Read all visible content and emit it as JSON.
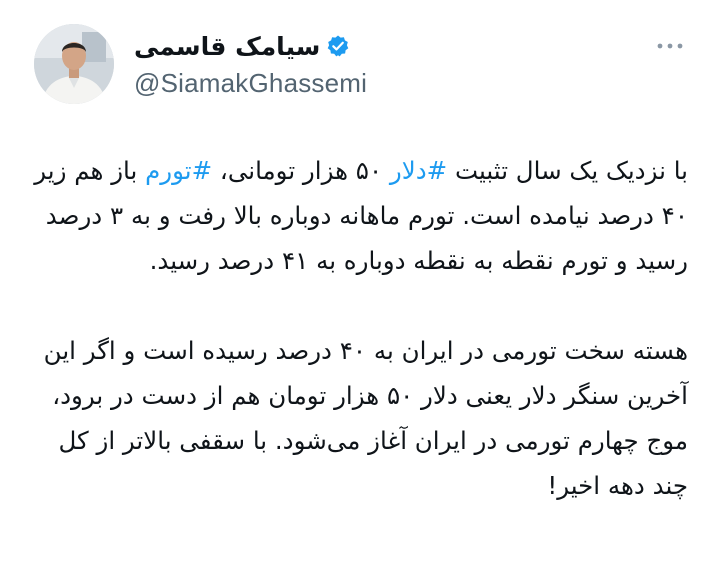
{
  "author": {
    "display_name": "سیامک قاسمی",
    "handle": "@SiamakGhassemi",
    "verified": true
  },
  "icons": {
    "verified": "verified-badge-icon",
    "more": "more-options-icon"
  },
  "colors": {
    "hashtag": "#1d9bf0",
    "verified_badge": "#1d9bf0",
    "handle_text": "#536471",
    "body_text": "#0f1419"
  },
  "tweet": {
    "p1": {
      "t1": "با نزدیک یک سال تثبیت ",
      "hashtag1": "#دلار",
      "t2": " ۵۰ هزار تومانی، ",
      "hashtag2": "#تورم",
      "t3": " باز هم زیر ۴۰ درصد نیامده است. تورم ماهانه دوباره بالا رفت و به ۳ درصد رسید و تورم نقطه به نقطه دوباره به ۴۱ درصد رسید."
    },
    "p2": "هسته سخت تورمی در ایران به ۴۰ درصد رسیده است و اگر این آخرین سنگر دلار یعنی دلار ۵۰ هزار تومان هم از دست در برود، موج چهارم تورمی در ایران آغاز می‌شود. با سقفی بالاتر از کل چند دهه اخیر!"
  }
}
